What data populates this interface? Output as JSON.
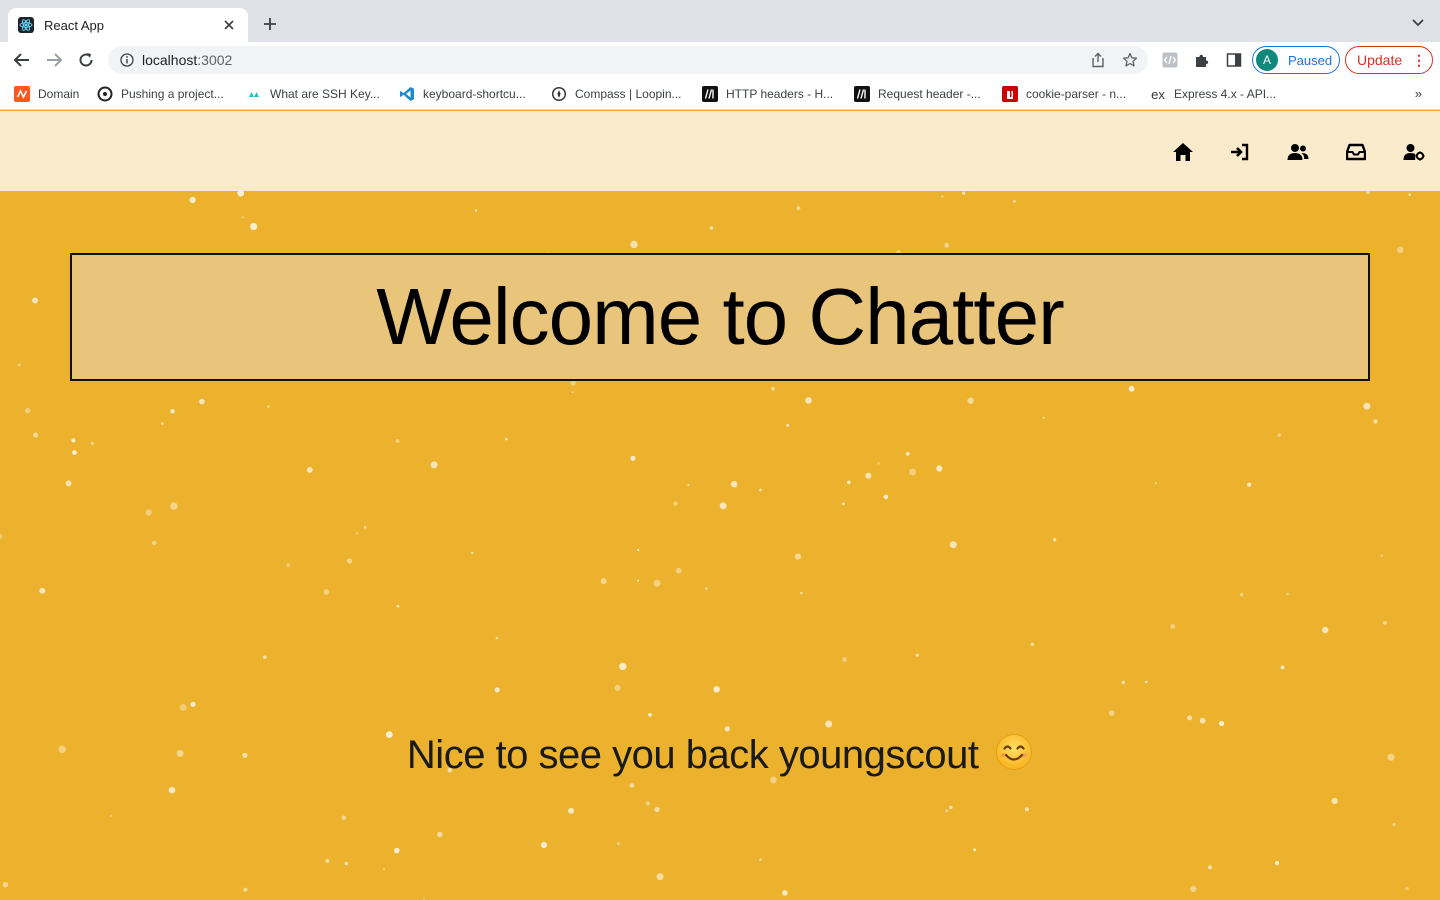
{
  "browser": {
    "tab_title": "React App",
    "url_host": "localhost",
    "url_port": ":3002",
    "profile_initial": "A",
    "profile_status": "Paused",
    "update_label": "Update",
    "bookmarks": [
      {
        "label": "Domain",
        "icon": "domain-icon",
        "color": "#ff5722"
      },
      {
        "label": "Pushing a project...",
        "icon": "git-icon",
        "color": "#222222"
      },
      {
        "label": "What are SSH Key...",
        "icon": "ssh-icon",
        "color": "#20c3c3"
      },
      {
        "label": "keyboard-shortcu...",
        "icon": "vscode-icon",
        "color": "#1f8ad2"
      },
      {
        "label": "Compass | Loopin...",
        "icon": "compass-icon",
        "color": "#333333"
      },
      {
        "label": "HTTP headers - H...",
        "icon": "mdn-icon",
        "color": "#111111"
      },
      {
        "label": "Request header -...",
        "icon": "mdn-icon",
        "color": "#111111"
      },
      {
        "label": "cookie-parser - n...",
        "icon": "npm-icon",
        "color": "#cb0000"
      },
      {
        "label": "Express 4.x - API...",
        "icon": "express-icon",
        "color": "#333333"
      }
    ],
    "bookmarks_more": "»"
  },
  "app": {
    "nav_icons": [
      "home-icon",
      "login-icon",
      "users-icon",
      "inbox-icon",
      "user-settings-icon"
    ],
    "nav_background": "#faebcd",
    "background": "#ecb22e",
    "welcome_box_color": "#e8c57a",
    "welcome_title": "Welcome to Chatter",
    "greeting": "Nice to see you back youngscout",
    "greeting_emoji": "smiling-face-icon"
  }
}
